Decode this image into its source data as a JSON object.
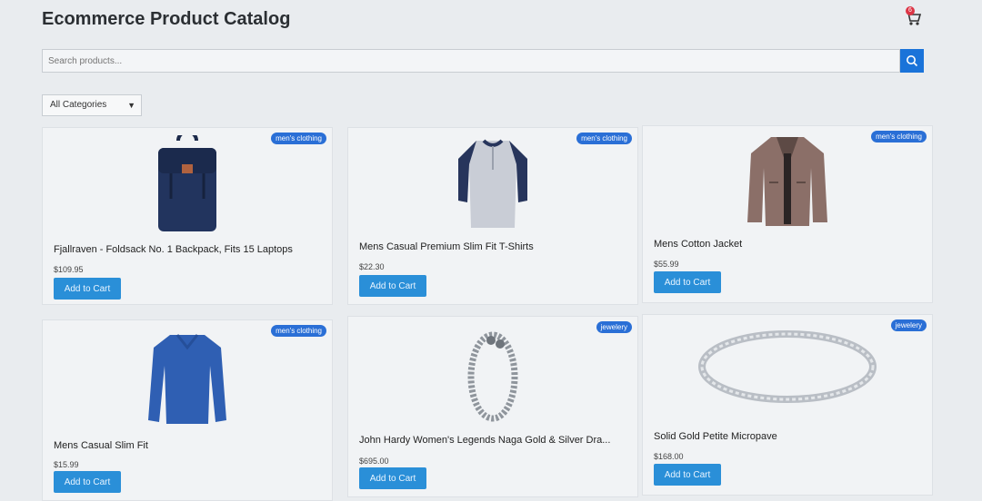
{
  "header": {
    "title": "Ecommerce Product Catalog",
    "cart_count": "6"
  },
  "search": {
    "placeholder": "Search products..."
  },
  "filter": {
    "selected": "All Categories"
  },
  "products": [
    {
      "name": "Fjallraven - Foldsack No. 1 Backpack, Fits 15 Laptops",
      "price": "$109.95",
      "category": "men's clothing",
      "button": "Add to Cart",
      "icon": "backpack-image"
    },
    {
      "name": "Mens Casual Premium Slim Fit T-Shirts",
      "price": "$22.30",
      "category": "men's clothing",
      "button": "Add to Cart",
      "icon": "tshirt-image"
    },
    {
      "name": "Mens Cotton Jacket",
      "price": "$55.99",
      "category": "men's clothing",
      "button": "Add to Cart",
      "icon": "jacket-image"
    },
    {
      "name": "Mens Casual Slim Fit",
      "price": "$15.99",
      "category": "men's clothing",
      "button": "Add to Cart",
      "icon": "longsleeve-image"
    },
    {
      "name": "John Hardy Women's Legends Naga Gold & Silver Dra...",
      "price": "$695.00",
      "category": "jewelery",
      "button": "Add to Cart",
      "icon": "bracelet-image"
    },
    {
      "name": "Solid Gold Petite Micropave",
      "price": "$168.00",
      "category": "jewelery",
      "button": "Add to Cart",
      "icon": "ring-image"
    }
  ]
}
